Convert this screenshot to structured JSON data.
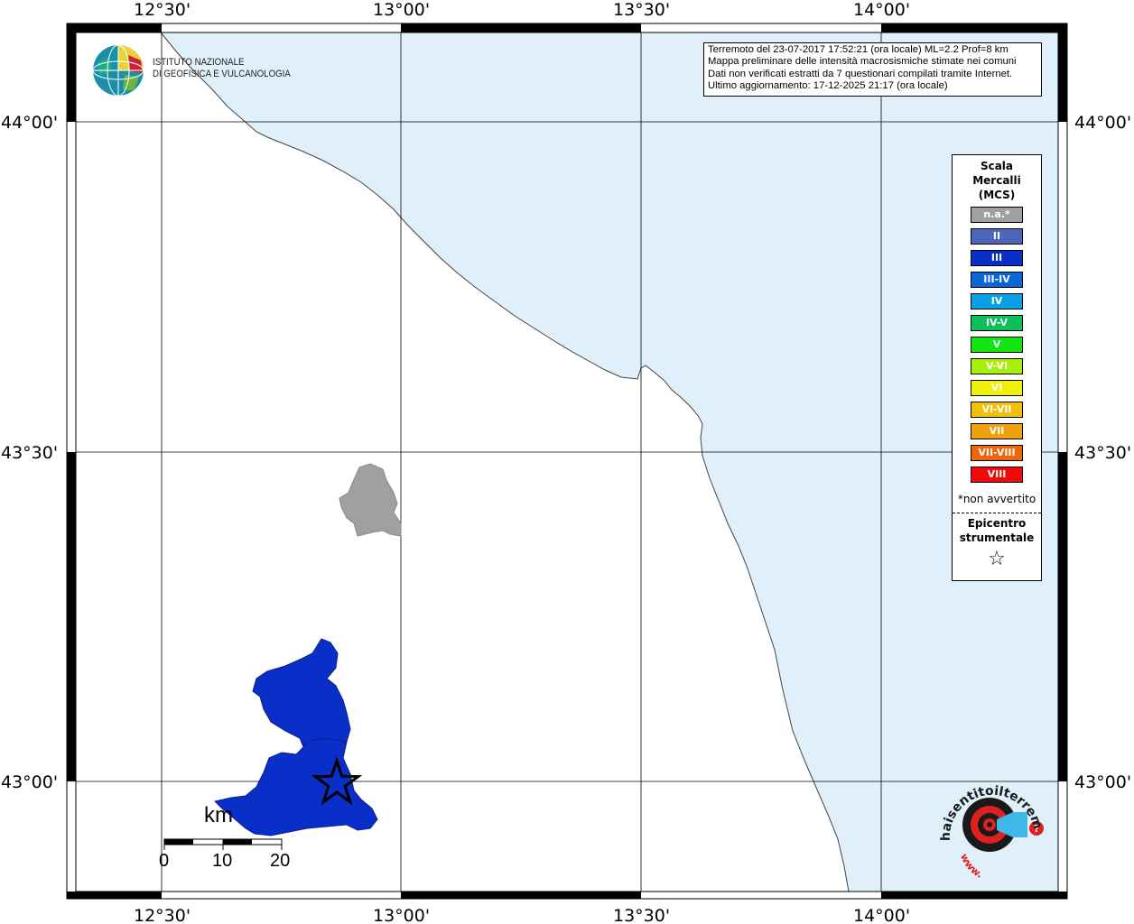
{
  "map": {
    "top_lon_labels": [
      "12°30'",
      "13°00'",
      "13°30'",
      "14°00'"
    ],
    "bottom_lon_labels": [
      "12°30'",
      "13°00'",
      "13°30'",
      "14°00'"
    ],
    "left_lat_labels": [
      "44°00'",
      "43°30'",
      "43°00'"
    ],
    "right_lat_labels": [
      "44°00'",
      "43°30'",
      "43°00'"
    ],
    "sea_color": "#dff0fb",
    "land_color": "#ffffff"
  },
  "info": {
    "line1": "Terremoto del 23-07-2017 17:52:21 (ora locale) ML=2.2 Prof=8 km",
    "line2": "Mappa preliminare delle intensità macrosismiche stimate nei comuni",
    "line3": "Dati non verificati estratti da 7 questionari compilati tramite Internet.",
    "line4": "Ultimo aggiornamento: 17-12-2025 21:17 (ora locale)"
  },
  "institute": {
    "line1": "ISTITUTO NAZIONALE",
    "line2": "DI GEOFISICA E VULCANOLOGIA"
  },
  "legend": {
    "title1": "Scala",
    "title2": "Mercalli",
    "title3": "(MCS)",
    "items": [
      {
        "label": "n.a.*",
        "color": "#a0a0a0"
      },
      {
        "label": "II",
        "color": "#4d66b8"
      },
      {
        "label": "III",
        "color": "#0a2ec8"
      },
      {
        "label": "III-IV",
        "color": "#0a66d6"
      },
      {
        "label": "IV",
        "color": "#0aa0e6"
      },
      {
        "label": "IV-V",
        "color": "#0cbf5a"
      },
      {
        "label": "V",
        "color": "#12e612"
      },
      {
        "label": "V-VI",
        "color": "#a8f00a"
      },
      {
        "label": "VI",
        "color": "#f0f00a"
      },
      {
        "label": "VI-VII",
        "color": "#f0c00a"
      },
      {
        "label": "VII",
        "color": "#f0a00a"
      },
      {
        "label": "VII-VIII",
        "color": "#f0640a"
      },
      {
        "label": "VIII",
        "color": "#f00a0a"
      }
    ],
    "note": "*non avvertito",
    "epi1": "Epicentro",
    "epi2": "strumentale",
    "star": "☆"
  },
  "scalebar": {
    "unit": "km",
    "labels": [
      "0",
      "10",
      "20"
    ]
  },
  "regions": [
    {
      "name": "grey-commune",
      "intensity": "n.a.*",
      "color": "#a0a0a0"
    },
    {
      "name": "blue-commune",
      "intensity": "III",
      "color": "#0a2ec8"
    }
  ],
  "hst": {
    "text": "haisentitoilterremoto.it",
    "www": "www.",
    "accent": "#e02020"
  }
}
